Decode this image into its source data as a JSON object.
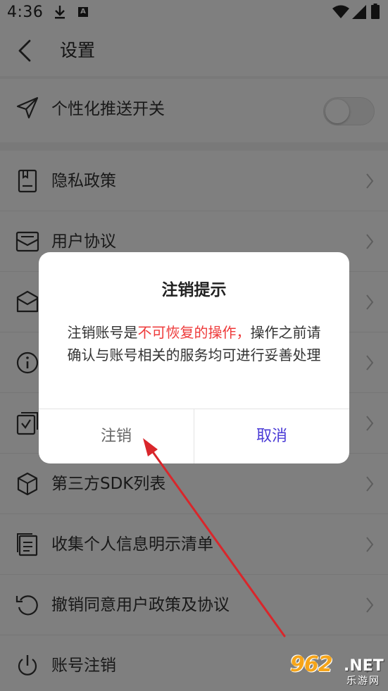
{
  "status_bar": {
    "time": "4:36",
    "download_icon": "download-icon",
    "notification_badge": "A",
    "wifi_icon": "wifi-icon",
    "signal_icon": "signal-icon",
    "battery_icon": "battery-icon"
  },
  "header": {
    "title": "设置",
    "back_icon": "chevron-left-icon"
  },
  "settings": {
    "push": {
      "label": "个性化推送开关",
      "icon": "send-icon",
      "toggle_on": false
    },
    "items": [
      {
        "label": "隐私政策",
        "icon": "document-icon"
      },
      {
        "label": "用户协议",
        "icon": "mail-icon"
      },
      {
        "label": "",
        "icon": "message-icon"
      },
      {
        "label": "",
        "icon": "info-icon"
      },
      {
        "label": "",
        "icon": "checklist-icon"
      },
      {
        "label": "第三方SDK列表",
        "icon": "cube-icon"
      },
      {
        "label": "收集个人信息明示清单",
        "icon": "list-icon"
      },
      {
        "label": "撤销同意用户政策及协议",
        "icon": "revoke-icon"
      },
      {
        "label": "账号注销",
        "icon": "power-icon"
      }
    ]
  },
  "dialog": {
    "title": "注销提示",
    "message_prefix": "注销账号是",
    "message_warning": "不可恢复的操作，",
    "message_suffix": "操作之前请确认与账号相关的服务均可进行妥善处理",
    "confirm_label": "注销",
    "cancel_label": "取消",
    "warning_color": "#ee3a3a",
    "cancel_color": "#4a3bd6"
  },
  "annotation": {
    "arrow_color": "#d9262b"
  },
  "watermark": {
    "number": "962",
    "domain": ".NET",
    "caption": "乐游网"
  }
}
